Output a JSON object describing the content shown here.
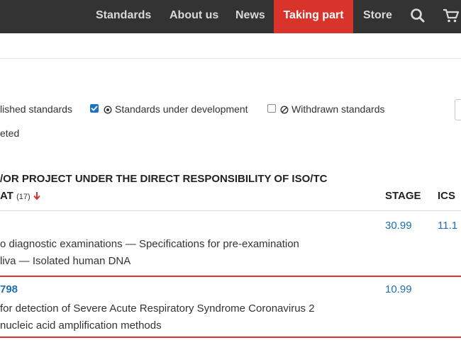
{
  "nav": {
    "items": [
      "Standards",
      "About us",
      "News",
      "Taking part",
      "Store"
    ],
    "active": "Taking part",
    "icons": [
      "search-icon",
      "cart-icon"
    ]
  },
  "filters": {
    "published_label": "lished standards",
    "development_label": "Standards under development",
    "withdrawn_label": "Withdrawn standards",
    "deleted_label": "eted",
    "development_checked": true,
    "withdrawn_checked": false
  },
  "section": {
    "heading_line1": "/OR PROJECT UNDER THE DIRECT RESPONSIBILITY OF ISO/TC",
    "heading_line2_prefix": "AT",
    "count": "(17)",
    "stage_header": "STAGE",
    "ics_header": "ICS"
  },
  "rows": [
    {
      "id": "",
      "title_line1": "o diagnostic examinations — Specifications for pre-examination",
      "title_line2": "liva — Isolated human DNA",
      "stage": "30.99",
      "ics": "11.1"
    },
    {
      "id": "798",
      "title_line1": "for detection of Severe Acute Respiratory Syndrome Coronavirus 2",
      "title_line2": "nucleic acid amplification methods",
      "stage": "10.99",
      "ics": ""
    }
  ],
  "colors": {
    "accent": "#d9342b",
    "link": "#1f6fb2",
    "topbar": "#333333",
    "highlight": "#e0332b"
  }
}
